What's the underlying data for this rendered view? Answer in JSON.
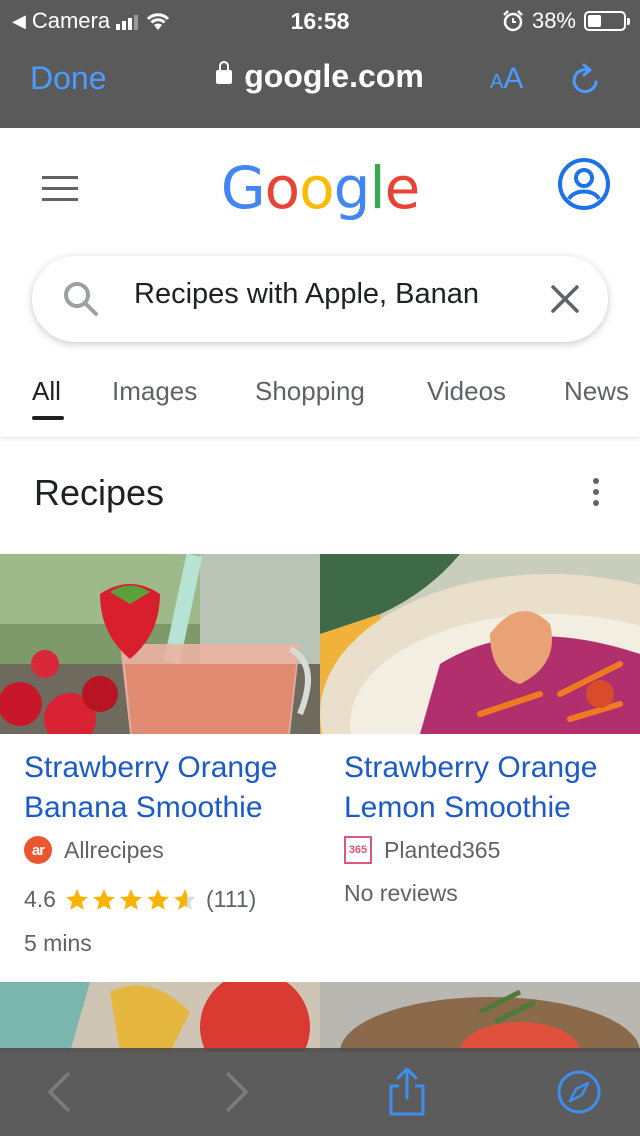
{
  "status_bar": {
    "back_app": "Camera",
    "time": "16:58",
    "battery_percent": "38%",
    "battery_level": 0.38
  },
  "safari": {
    "done_label": "Done",
    "url": "google.com",
    "text_size_label_small": "A",
    "text_size_label_large": "A"
  },
  "google": {
    "logo_letters": [
      {
        "char": "G",
        "color": "#4285F4"
      },
      {
        "char": "o",
        "color": "#EA4335"
      },
      {
        "char": "o",
        "color": "#FBBC05"
      },
      {
        "char": "g",
        "color": "#4285F4"
      },
      {
        "char": "l",
        "color": "#34A853"
      },
      {
        "char": "e",
        "color": "#EA4335"
      }
    ],
    "accent_color": "#1a73e8"
  },
  "search": {
    "query": "Recipes with Apple, Banan"
  },
  "tabs": [
    {
      "label": "All",
      "active": true
    },
    {
      "label": "Images",
      "active": false
    },
    {
      "label": "Shopping",
      "active": false
    },
    {
      "label": "Videos",
      "active": false
    },
    {
      "label": "News",
      "active": false
    }
  ],
  "recipes": {
    "heading": "Recipes",
    "cards": [
      {
        "title": "Strawberry Orange Banana Smoothie",
        "source": "Allrecipes",
        "source_logo_text": "ar",
        "rating": "4.6",
        "rating_value": 4.6,
        "review_count": "(111)",
        "time": "5 mins"
      },
      {
        "title": "Strawberry Orange Lemon Smoothie",
        "source": "Planted365",
        "source_logo_text": "365",
        "reviews_text": "No reviews"
      }
    ]
  },
  "toolbar": {
    "icons": [
      "back-icon",
      "forward-icon",
      "share-icon",
      "compass-icon"
    ]
  }
}
